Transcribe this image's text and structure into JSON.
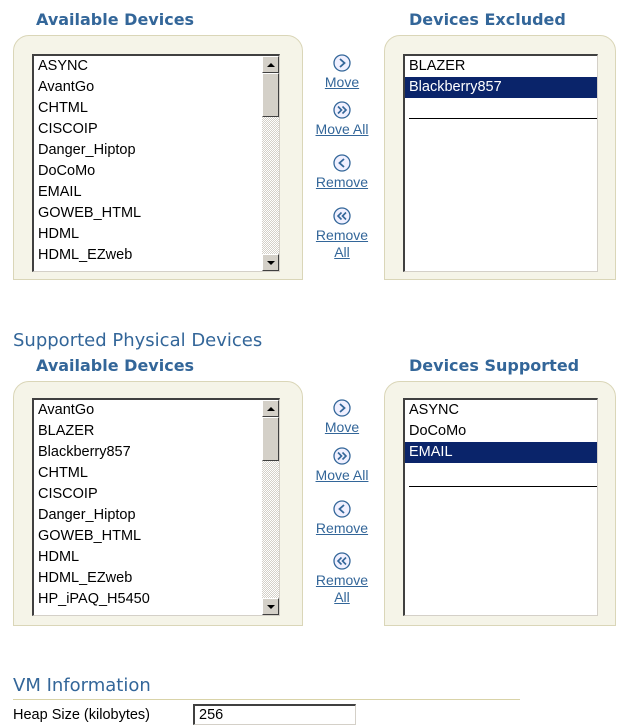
{
  "excluded_shuttle": {
    "available_heading": "Available Devices",
    "selected_heading": "Devices Excluded",
    "available": [
      "ASYNC",
      "AvantGo",
      "CHTML",
      "CISCOIP",
      "Danger_Hiptop",
      "DoCoMo",
      "EMAIL",
      "GOWEB_HTML",
      "HDML",
      "HDML_EZweb"
    ],
    "selected": [
      "BLAZER",
      "Blackberry857"
    ],
    "selected_highlighted": "Blackberry857"
  },
  "supported_section": {
    "title": "Supported Physical Devices",
    "available_heading": "Available Devices",
    "selected_heading": "Devices Supported",
    "available": [
      "AvantGo",
      "BLAZER",
      "Blackberry857",
      "CHTML",
      "CISCOIP",
      "Danger_Hiptop",
      "GOWEB_HTML",
      "HDML",
      "HDML_EZweb",
      "HP_iPAQ_H5450"
    ],
    "selected": [
      "ASYNC",
      "DoCoMo",
      "EMAIL"
    ],
    "selected_highlighted": "EMAIL"
  },
  "actions": {
    "move": "Move",
    "move_all": "Move All",
    "remove": "Remove",
    "remove_all_1": "Remove",
    "remove_all_2": "All"
  },
  "icons": {
    "move": "move-icon",
    "move_all": "move-all-icon",
    "remove": "remove-icon",
    "remove_all": "remove-all-icon"
  },
  "vm_section": {
    "title": "VM Information",
    "heap_label": "Heap Size (kilobytes)",
    "heap_value": "256"
  },
  "colors": {
    "heading": "#336699",
    "panel_bg": "#f5f4e8",
    "selection": "#0a246a"
  }
}
